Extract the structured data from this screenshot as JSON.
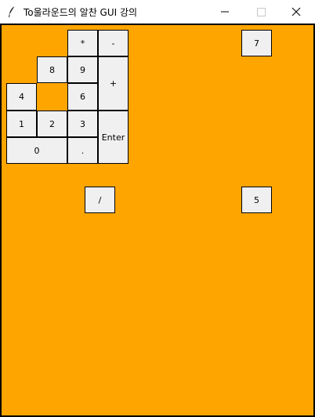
{
  "window": {
    "title": "To울라운드의 알찬 GUI 강의",
    "icon": "feather-icon",
    "controls": [
      "minimize-icon",
      "maximize-icon",
      "close-icon"
    ]
  },
  "canvas": {
    "background": "#ffa500",
    "border_color": "#000000"
  },
  "keypad": {
    "star": "*",
    "minus": "-",
    "eight": "8",
    "nine": "9",
    "plus": "+",
    "four": "4",
    "six": "6",
    "one": "1",
    "two": "2",
    "three": "3",
    "enter": "Enter",
    "zero": "0",
    "dot": "."
  },
  "extra_buttons": {
    "seven": "7",
    "slash": "/",
    "five": "5"
  }
}
